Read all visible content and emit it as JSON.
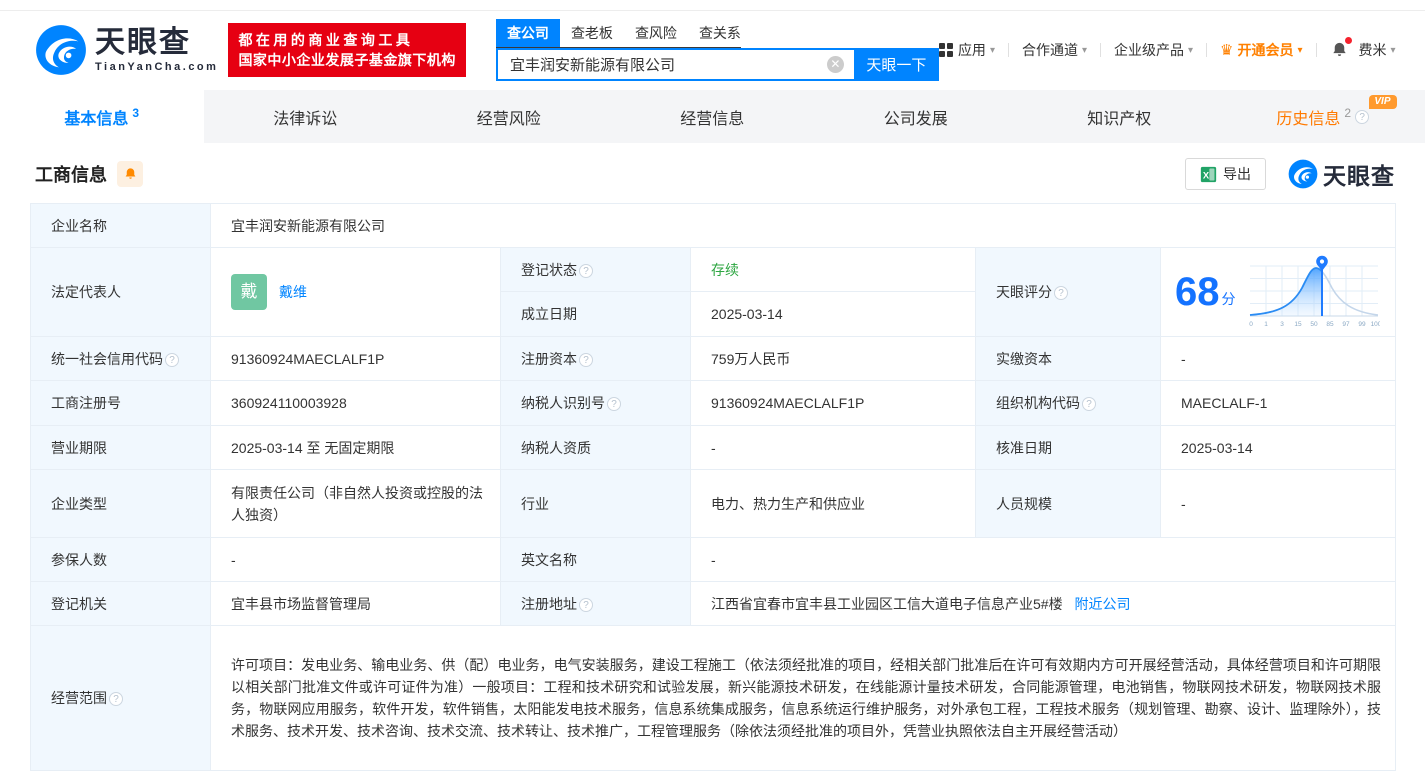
{
  "header": {
    "logo_title": "天眼查",
    "logo_subtitle": "TianYanCha.com",
    "slogan_line1": "都在用的商业查询工具",
    "slogan_line2": "国家中小企业发展子基金旗下机构",
    "search_tabs": [
      {
        "label": "查公司"
      },
      {
        "label": "查老板"
      },
      {
        "label": "查风险"
      },
      {
        "label": "查关系"
      }
    ],
    "search_value": "宜丰润安新能源有限公司",
    "search_button": "天眼一下",
    "nav": {
      "apps": "应用",
      "partner": "合作通道",
      "enterprise": "企业级产品",
      "vip": "开通会员",
      "username": "费米"
    }
  },
  "tabs": [
    {
      "label": "基本信息",
      "count": "3"
    },
    {
      "label": "法律诉讼"
    },
    {
      "label": "经营风险"
    },
    {
      "label": "经营信息"
    },
    {
      "label": "公司发展"
    },
    {
      "label": "知识产权"
    },
    {
      "label": "历史信息",
      "count": "2",
      "badge": "VIP"
    }
  ],
  "section": {
    "title": "工商信息",
    "export_label": "导出",
    "watermark": "天眼查"
  },
  "company": {
    "name_label": "企业名称",
    "name": "宜丰润安新能源有限公司",
    "legal_rep_label": "法定代表人",
    "legal_rep_avatar": "戴",
    "legal_rep_name": "戴维",
    "reg_status_label": "登记状态",
    "reg_status": "存续",
    "est_date_label": "成立日期",
    "est_date": "2025-03-14",
    "score_label": "天眼评分",
    "score": "68",
    "score_unit": "分",
    "score_ticks": [
      "0",
      "1",
      "3",
      "15",
      "50",
      "85",
      "97",
      "99",
      "100"
    ],
    "credit_code_label": "统一社会信用代码",
    "credit_code": "91360924MAECLALF1P",
    "reg_capital_label": "注册资本",
    "reg_capital": "759万人民币",
    "paid_capital_label": "实缴资本",
    "paid_capital": "-",
    "reg_number_label": "工商注册号",
    "reg_number": "360924110003928",
    "taxpayer_id_label": "纳税人识别号",
    "taxpayer_id": "91360924MAECLALF1P",
    "org_code_label": "组织机构代码",
    "org_code": "MAECLALF-1",
    "business_term_label": "营业期限",
    "business_term": "2025-03-14 至 无固定期限",
    "taxpayer_quality_label": "纳税人资质",
    "taxpayer_quality": "-",
    "approval_date_label": "核准日期",
    "approval_date": "2025-03-14",
    "company_type_label": "企业类型",
    "company_type": "有限责任公司（非自然人投资或控股的法人独资）",
    "industry_label": "行业",
    "industry": "电力、热力生产和供应业",
    "staff_size_label": "人员规模",
    "staff_size": "-",
    "insured_label": "参保人数",
    "insured": "-",
    "english_name_label": "英文名称",
    "english_name": "-",
    "reg_authority_label": "登记机关",
    "reg_authority": "宜丰县市场监督管理局",
    "address_label": "注册地址",
    "address": "江西省宜春市宜丰县工业园区工信大道电子信息产业5#楼",
    "address_link": "附近公司",
    "business_scope_label": "经营范围",
    "business_scope": "许可项目：发电业务、输电业务、供（配）电业务，电气安装服务，建设工程施工（依法须经批准的项目，经相关部门批准后在许可有效期内方可开展经营活动，具体经营项目和许可期限以相关部门批准文件或许可证件为准）一般项目：工程和技术研究和试验发展，新兴能源技术研发，在线能源计量技术研发，合同能源管理，电池销售，物联网技术研发，物联网技术服务，物联网应用服务，软件开发，软件销售，太阳能发电技术服务，信息系统集成服务，信息系统运行维护服务，对外承包工程，工程技术服务（规划管理、勘察、设计、监理除外），技术服务、技术开发、技术咨询、技术交流、技术转让、技术推广，工程管理服务（除依法须经批准的项目外，凭营业执照依法自主开展经营活动）"
  },
  "colors": {
    "brand_blue": "#0084ff",
    "banner_red": "#e60012",
    "vip_orange": "#ff8000",
    "status_green": "#2da641",
    "avatar_green": "#70c7a2",
    "score_blue": "#1472ff"
  }
}
